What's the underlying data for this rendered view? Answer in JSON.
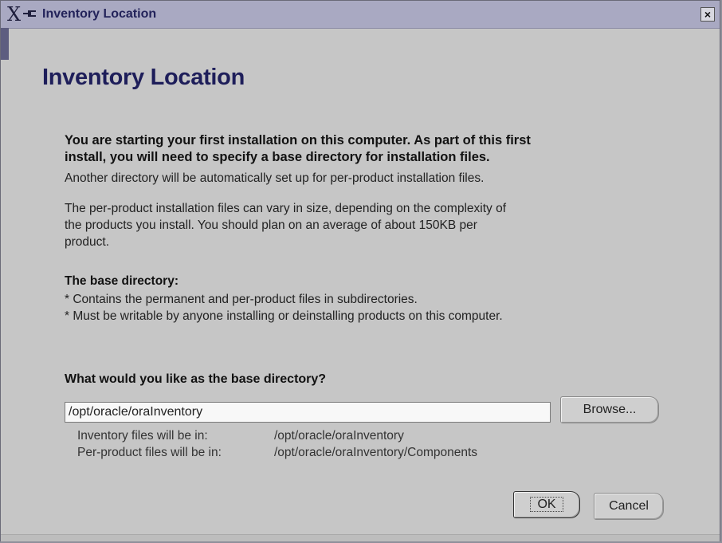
{
  "window": {
    "title": "Inventory Location",
    "close_label": "×"
  },
  "page": {
    "heading": "Inventory Location",
    "intro_bold_1": "You are starting your first installation on this computer. As part of this first",
    "intro_bold_2": "install, you will need to specify a base directory for installation files.",
    "auto_dir": "Another directory will be automatically set up for per-product installation files.",
    "size_1": "The per-product installation files can vary in size, depending on the complexity of",
    "size_2": "the products you install.  You should plan on an average of about 150KB per",
    "size_3": "product.",
    "base_title": "The base directory:",
    "bullet_1": "* Contains the permanent and per-product files in subdirectories.",
    "bullet_2": "* Must be writable by anyone installing or deinstalling products on this computer.",
    "question": "What would you like as the base directory?"
  },
  "input": {
    "value": "/opt/oracle/oraInventory"
  },
  "browse_label": "Browse...",
  "info": {
    "inventory_label": "Inventory files will be in:",
    "inventory_value": "/opt/oracle/oraInventory",
    "perproduct_label": "Per-product files will be in:",
    "perproduct_value": "/opt/oracle/oraInventory/Components"
  },
  "buttons": {
    "ok": "OK",
    "cancel": "Cancel"
  }
}
